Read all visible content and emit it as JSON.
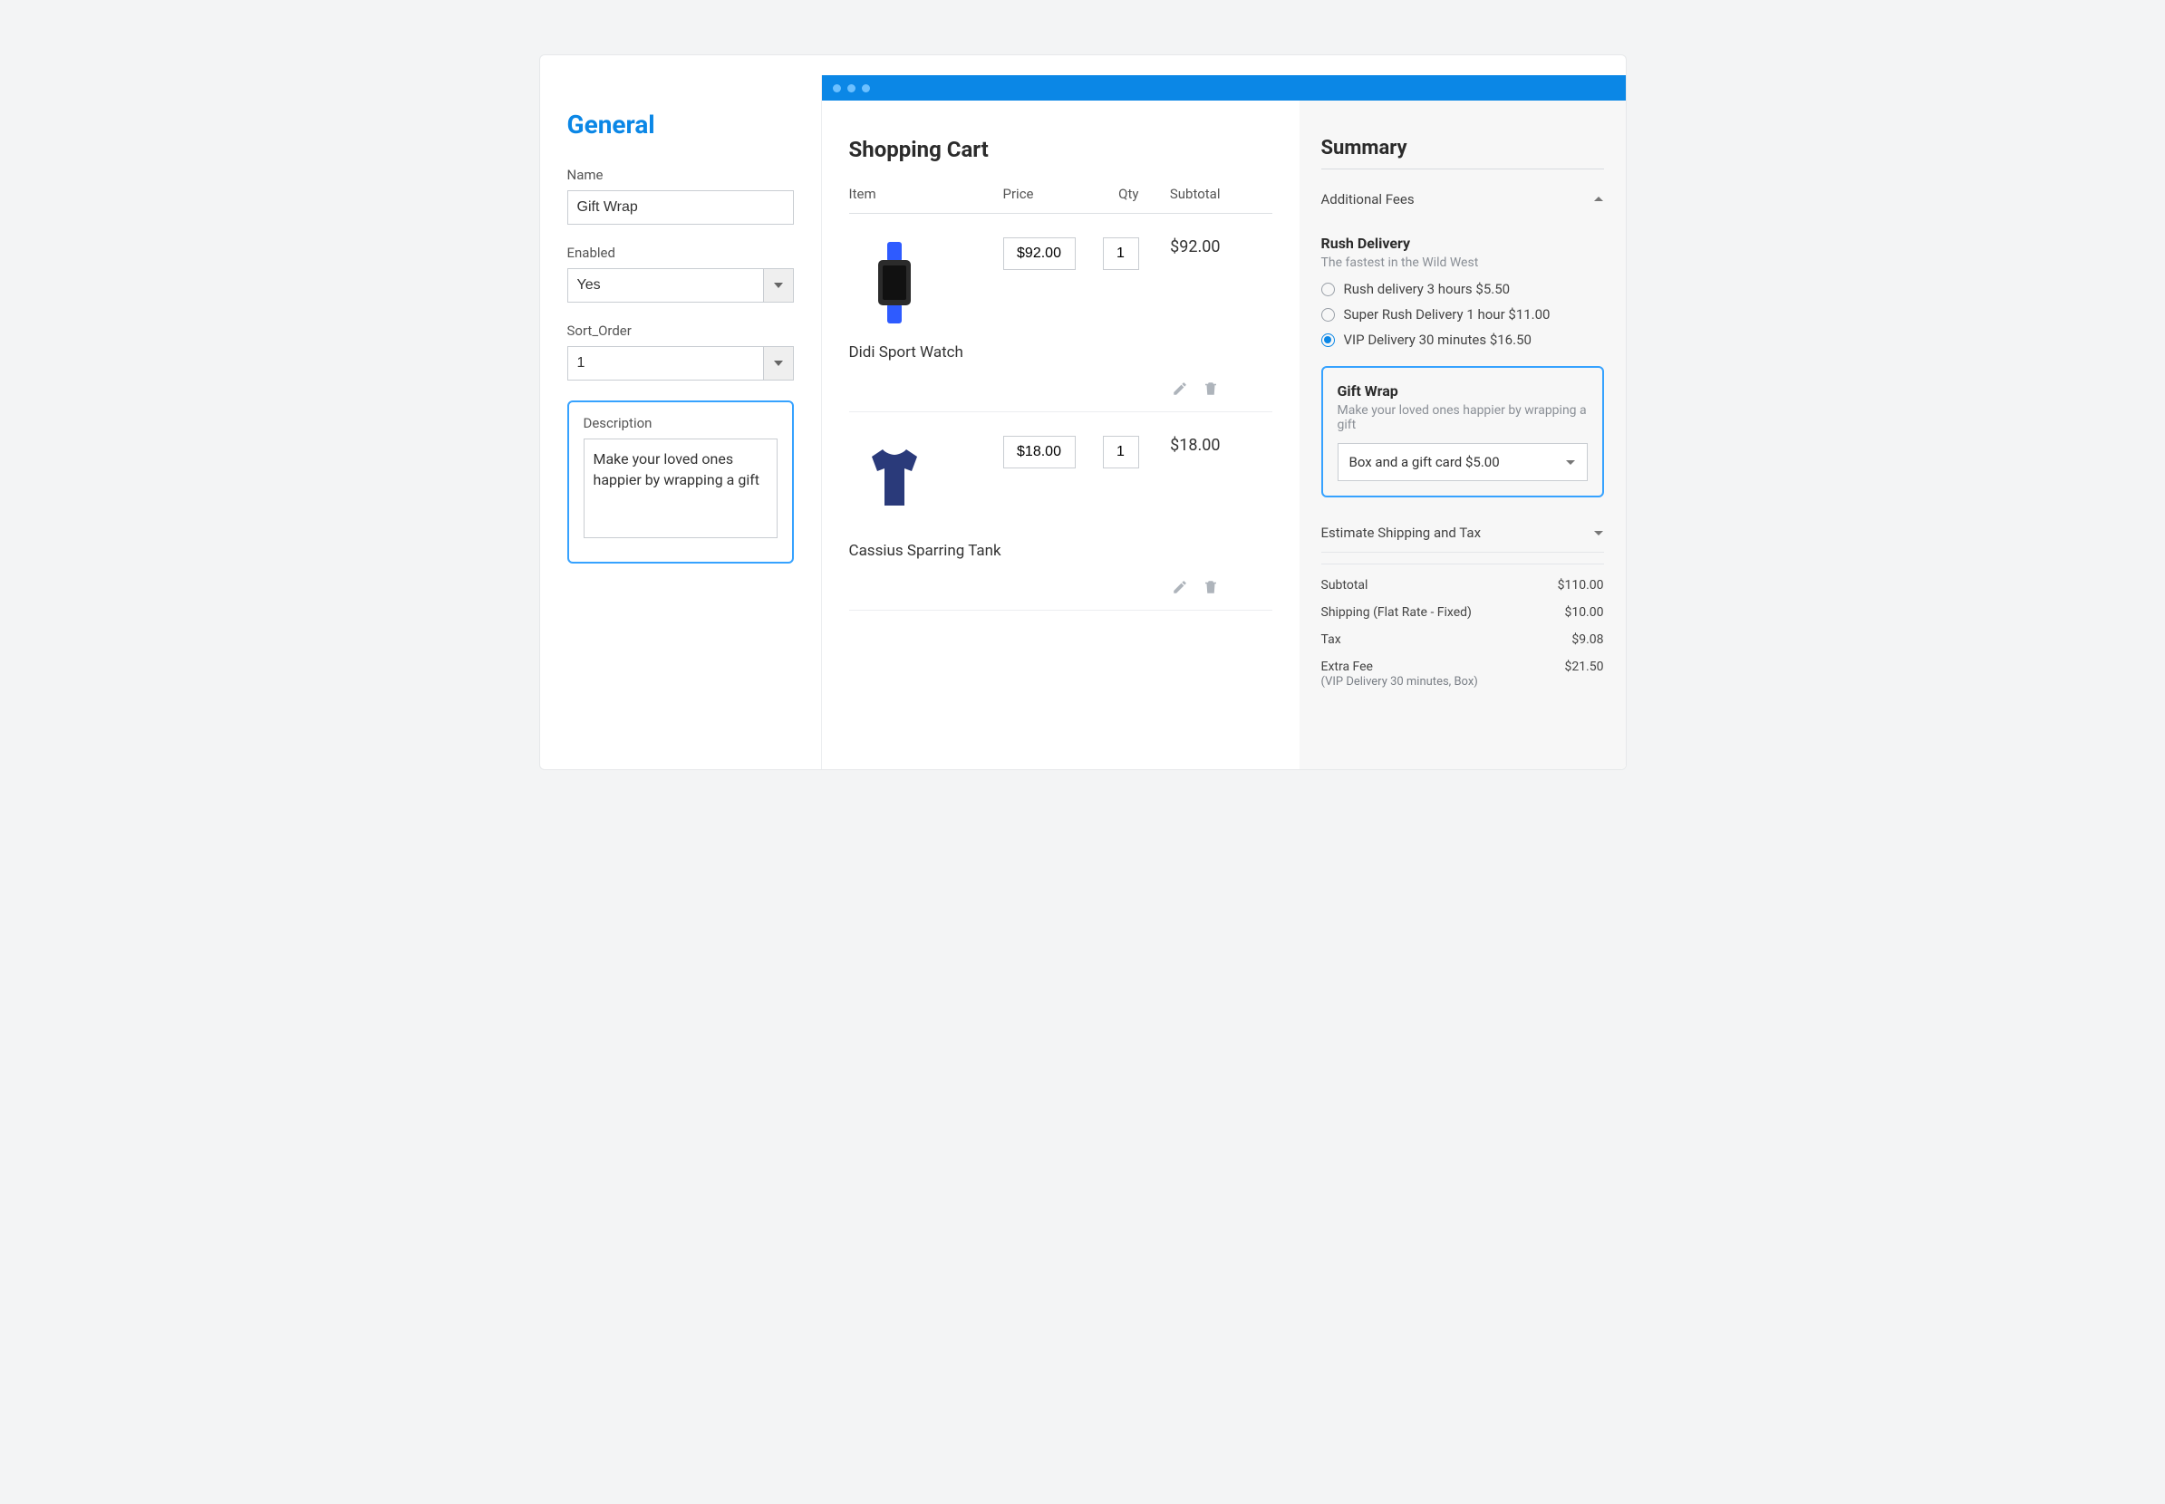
{
  "admin": {
    "title": "General",
    "name_label": "Name",
    "name_value": "Gift Wrap",
    "enabled_label": "Enabled",
    "enabled_value": "Yes",
    "sort_label": "Sort_Order",
    "sort_value": "1",
    "desc_label": "Description",
    "desc_value": "Make your loved ones happier by wrapping a gift"
  },
  "cart": {
    "title": "Shopping Cart",
    "headers": {
      "item": "Item",
      "price": "Price",
      "qty": "Qty",
      "subtotal": "Subtotal"
    },
    "items": [
      {
        "name": "Didi Sport Watch",
        "price": "$92.00",
        "qty": "1",
        "subtotal": "$92.00"
      },
      {
        "name": "Cassius Sparring Tank",
        "price": "$18.00",
        "qty": "1",
        "subtotal": "$18.00"
      }
    ]
  },
  "summary": {
    "title": "Summary",
    "additional_fees_label": "Additional Fees",
    "rush": {
      "title": "Rush Delivery",
      "subtitle": "The fastest in the Wild West",
      "options": [
        {
          "label": "Rush delivery 3 hours $5.50",
          "selected": false
        },
        {
          "label": "Super Rush Delivery 1 hour $11.00",
          "selected": false
        },
        {
          "label": "VIP Delivery 30 minutes $16.50",
          "selected": true
        }
      ]
    },
    "gift": {
      "title": "Gift Wrap",
      "subtitle": "Make your loved ones happier by wrapping a gift",
      "selected": "Box and a gift card $5.00"
    },
    "estimate_label": "Estimate Shipping and Tax",
    "totals": [
      {
        "label": "Subtotal",
        "value": "$110.00"
      },
      {
        "label": "Shipping (Flat Rate - Fixed)",
        "value": "$10.00"
      },
      {
        "label": "Tax",
        "value": "$9.08"
      },
      {
        "label": "Extra Fee",
        "value": "$21.50",
        "sub": "(VIP Delivery 30 minutes, Box)"
      }
    ]
  }
}
